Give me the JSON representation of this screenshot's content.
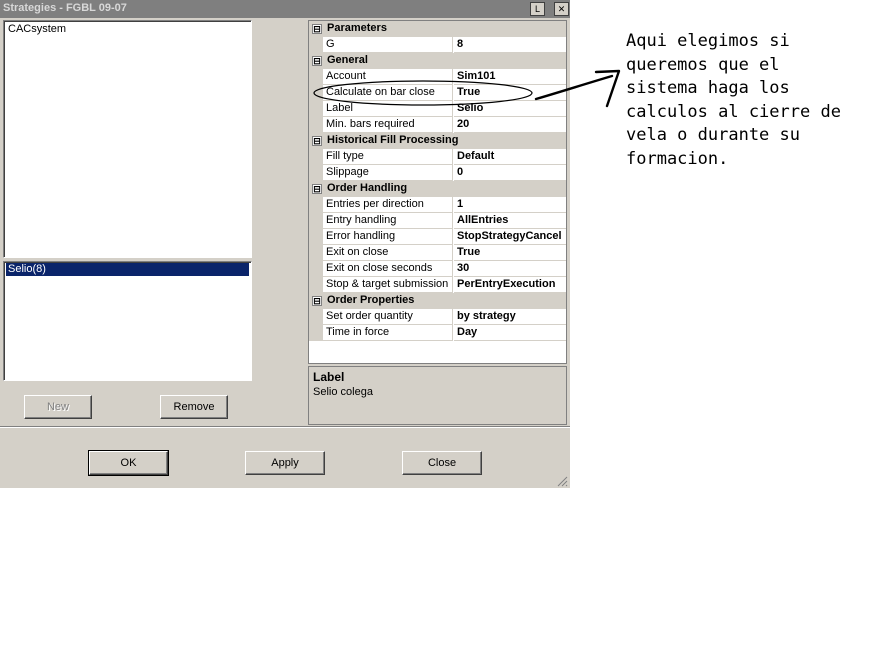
{
  "window": {
    "title": "Strategies - FGBL 09-07",
    "btn_l": "L",
    "btn_close": "✕"
  },
  "strategies_list": [
    "CACsystem"
  ],
  "active_list": [
    "Selio(8)"
  ],
  "buttons": {
    "new": "New",
    "remove": "Remove",
    "ok": "OK",
    "apply": "Apply",
    "close": "Close"
  },
  "grid": {
    "toggle_glyph": "⊟",
    "rows": [
      {
        "type": "cat",
        "label": "Parameters"
      },
      {
        "type": "prop",
        "name": "G",
        "value": "8"
      },
      {
        "type": "cat",
        "label": "General"
      },
      {
        "type": "prop",
        "name": "Account",
        "value": "Sim101"
      },
      {
        "type": "prop",
        "name": "Calculate on bar close",
        "value": "True"
      },
      {
        "type": "prop",
        "name": "Label",
        "value": "Selio"
      },
      {
        "type": "prop",
        "name": "Min. bars required",
        "value": "20"
      },
      {
        "type": "cat",
        "label": "Historical Fill Processing"
      },
      {
        "type": "prop",
        "name": "Fill type",
        "value": "Default"
      },
      {
        "type": "prop",
        "name": "Slippage",
        "value": "0"
      },
      {
        "type": "cat",
        "label": "Order Handling"
      },
      {
        "type": "prop",
        "name": "Entries per direction",
        "value": "1"
      },
      {
        "type": "prop",
        "name": "Entry handling",
        "value": "AllEntries"
      },
      {
        "type": "prop",
        "name": "Error handling",
        "value": "StopStrategyCancel"
      },
      {
        "type": "prop",
        "name": "Exit on close",
        "value": "True"
      },
      {
        "type": "prop",
        "name": "Exit on close seconds",
        "value": "30"
      },
      {
        "type": "prop",
        "name": "Stop & target submission",
        "value": "PerEntryExecution"
      },
      {
        "type": "cat",
        "label": "Order Properties"
      },
      {
        "type": "prop",
        "name": "Set order quantity",
        "value": "by strategy"
      },
      {
        "type": "prop",
        "name": "Time in force",
        "value": "Day"
      }
    ]
  },
  "description": {
    "title": "Label",
    "text": "Selio colega"
  },
  "annotation": {
    "lines": [
      "Aqui elegimos si",
      "queremos que el",
      "sistema haga los",
      "calculos al cierre de",
      "vela o durante su",
      "formacion."
    ]
  }
}
